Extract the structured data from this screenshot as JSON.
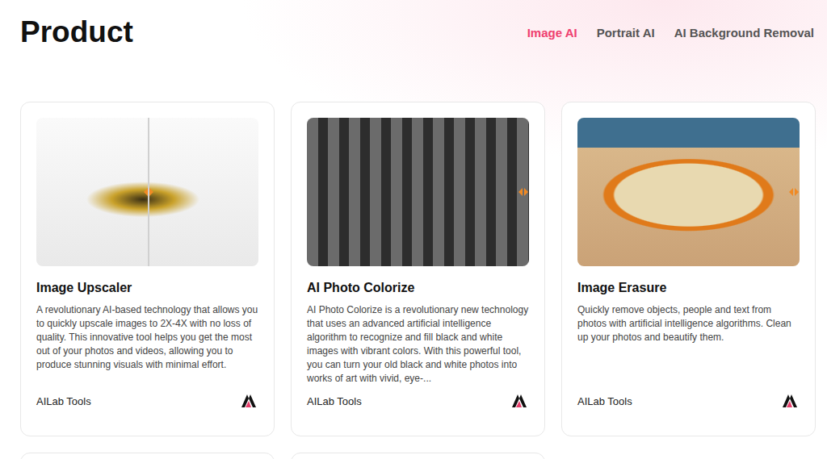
{
  "page": {
    "title": "Product"
  },
  "nav": [
    {
      "label": "Image AI",
      "selected": true
    },
    {
      "label": "Portrait AI",
      "selected": false
    },
    {
      "label": "AI Background Removal",
      "selected": false
    }
  ],
  "products": [
    {
      "kind": "upscale",
      "title": "Image Upscaler",
      "description": "A revolutionary AI-based technology that allows you to quickly upscale images to 2X-4X with no loss of quality. This innovative tool helps you get the most out of your photos and videos, allowing you to produce stunning visuals with minimal effort.",
      "brand": "AILab Tools"
    },
    {
      "kind": "colorize",
      "title": "AI Photo Colorize",
      "description": "AI Photo Colorize is a revolutionary new technology that uses an advanced artificial intelligence algorithm to recognize and fill black and white images with vibrant colors. With this powerful tool, you can turn your old black and white photos into works of art with vivid, eye-...",
      "brand": "AILab Tools"
    },
    {
      "kind": "erase",
      "title": "Image Erasure",
      "description": "Quickly remove objects, people and text from photos with artificial intelligence algorithms. Clean up your photos and beautify them.",
      "brand": "AILab Tools"
    }
  ]
}
